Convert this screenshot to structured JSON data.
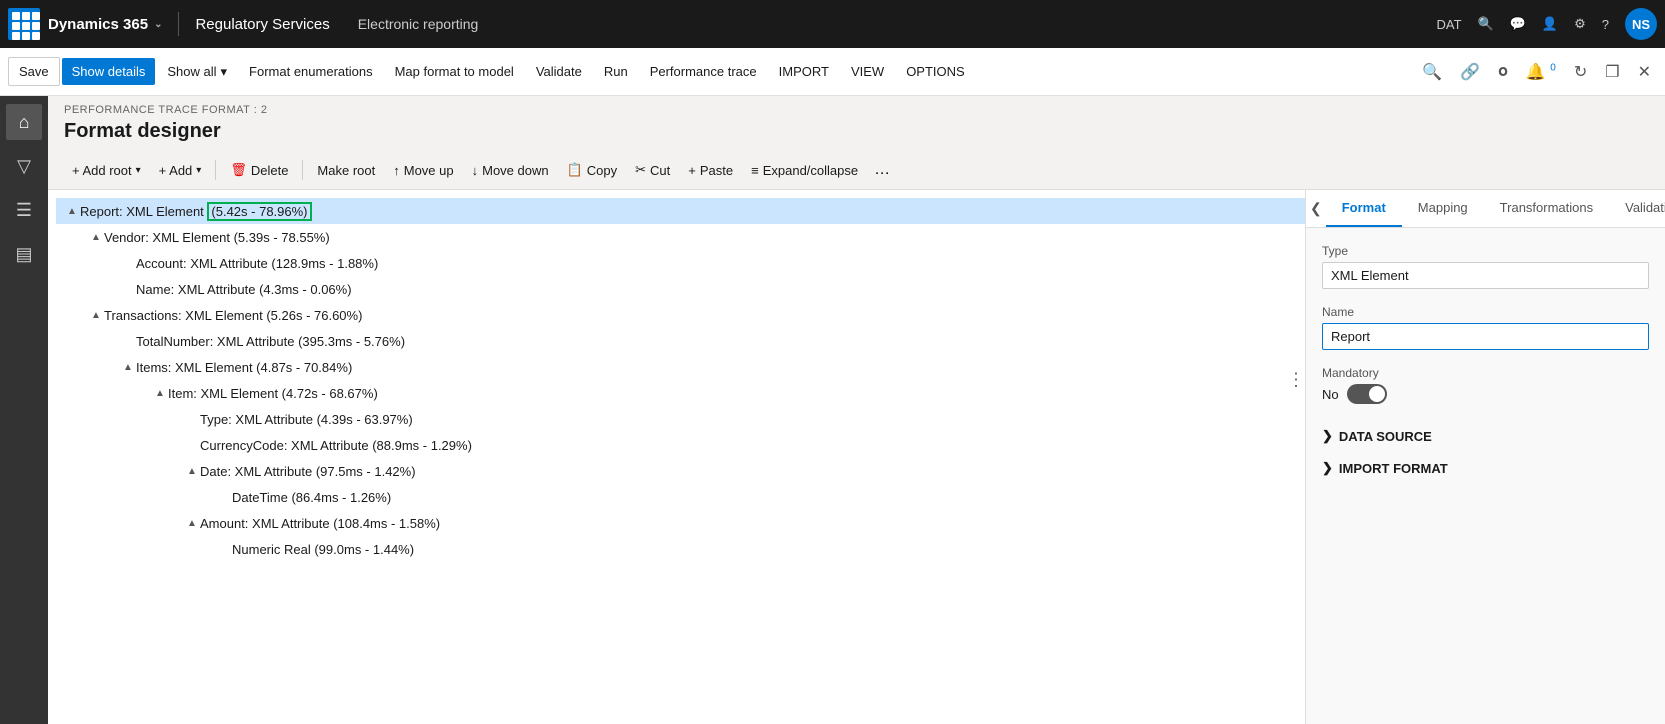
{
  "topbar": {
    "app_name": "Dynamics 365",
    "module": "Regulatory Services",
    "sub": "Electronic reporting",
    "env": "DAT",
    "user_initials": "NS"
  },
  "ribbon": {
    "save": "Save",
    "show_details": "Show details",
    "show_all": "Show all",
    "format_enumerations": "Format enumerations",
    "map_format_to_model": "Map format to model",
    "validate": "Validate",
    "run": "Run",
    "performance_trace": "Performance trace",
    "import": "IMPORT",
    "view": "VIEW",
    "options": "OPTIONS"
  },
  "breadcrumb": "PERFORMANCE TRACE FORMAT : 2",
  "page_title": "Format designer",
  "toolbar": {
    "add_root": "+ Add root",
    "add": "+ Add",
    "delete": "Delete",
    "make_root": "Make root",
    "move_up": "Move up",
    "move_down": "Move down",
    "copy": "Copy",
    "cut": "Cut",
    "paste": "Paste",
    "expand_collapse": "Expand/collapse"
  },
  "tree": [
    {
      "id": 1,
      "indent": 0,
      "toggle": "▲",
      "label": "Report: XML Element (5.42s - 78.96%)",
      "selected": true,
      "highlight": true,
      "perf": "(5.42s - 78.96%)"
    },
    {
      "id": 2,
      "indent": 1,
      "toggle": "▲",
      "label": "Vendor: XML Element (5.39s - 78.55%)",
      "selected": false
    },
    {
      "id": 3,
      "indent": 2,
      "toggle": "",
      "label": "Account: XML Attribute (128.9ms - 1.88%)",
      "selected": false
    },
    {
      "id": 4,
      "indent": 2,
      "toggle": "",
      "label": "Name: XML Attribute (4.3ms - 0.06%)",
      "selected": false
    },
    {
      "id": 5,
      "indent": 1,
      "toggle": "▲",
      "label": "Transactions: XML Element (5.26s - 76.60%)",
      "selected": false
    },
    {
      "id": 6,
      "indent": 2,
      "toggle": "",
      "label": "TotalNumber: XML Attribute (395.3ms - 5.76%)",
      "selected": false
    },
    {
      "id": 7,
      "indent": 2,
      "toggle": "▲",
      "label": "Items: XML Element (4.87s - 70.84%)",
      "selected": false
    },
    {
      "id": 8,
      "indent": 3,
      "toggle": "▲",
      "label": "Item: XML Element (4.72s - 68.67%)",
      "selected": false
    },
    {
      "id": 9,
      "indent": 4,
      "toggle": "",
      "label": "Type: XML Attribute (4.39s - 63.97%)",
      "selected": false
    },
    {
      "id": 10,
      "indent": 4,
      "toggle": "",
      "label": "CurrencyCode: XML Attribute (88.9ms - 1.29%)",
      "selected": false
    },
    {
      "id": 11,
      "indent": 4,
      "toggle": "▲",
      "label": "Date: XML Attribute (97.5ms - 1.42%)",
      "selected": false
    },
    {
      "id": 12,
      "indent": 5,
      "toggle": "",
      "label": "DateTime (86.4ms - 1.26%)",
      "selected": false
    },
    {
      "id": 13,
      "indent": 4,
      "toggle": "▲",
      "label": "Amount: XML Attribute (108.4ms - 1.58%)",
      "selected": false
    },
    {
      "id": 14,
      "indent": 5,
      "toggle": "",
      "label": "Numeric Real (99.0ms - 1.44%)",
      "selected": false
    }
  ],
  "right_panel": {
    "tabs": [
      "Format",
      "Mapping",
      "Transformations",
      "Validations"
    ],
    "active_tab": "Format",
    "type_label": "Type",
    "type_value": "XML Element",
    "name_label": "Name",
    "name_value": "Report",
    "mandatory_label": "Mandatory",
    "mandatory_no": "No",
    "toggle_on": true,
    "data_source_label": "DATA SOURCE",
    "import_format_label": "IMPORT FORMAT"
  }
}
